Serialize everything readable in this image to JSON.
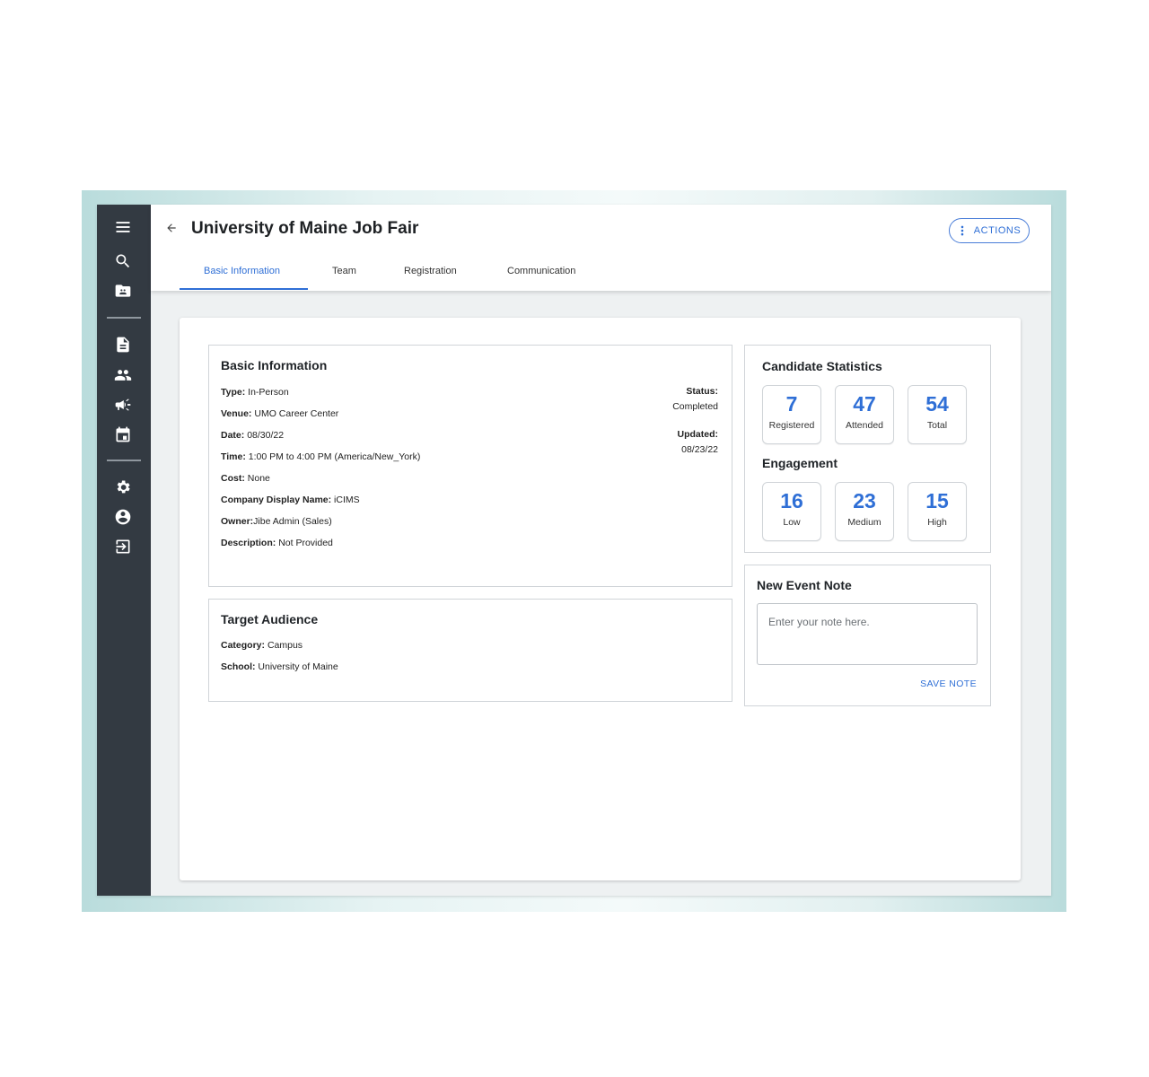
{
  "sidebar": {
    "icons": [
      "menu-icon",
      "search-icon",
      "folder-icon",
      "document-icon",
      "people-icon",
      "megaphone-icon",
      "calendar-icon",
      "gear-icon",
      "account-circle-icon",
      "logout-icon"
    ]
  },
  "header": {
    "title": "University of Maine Job Fair",
    "actions_label": "ACTIONS",
    "tabs": [
      {
        "label": "Basic Information",
        "active": true
      },
      {
        "label": "Team",
        "active": false
      },
      {
        "label": "Registration",
        "active": false
      },
      {
        "label": "Communication",
        "active": false
      }
    ]
  },
  "basic_info": {
    "title": "Basic Information",
    "fields": [
      {
        "label": "Type:",
        "value": "In-Person"
      },
      {
        "label": "Venue:",
        "value": "UMO Career Center"
      },
      {
        "label": "Date:",
        "value": "08/30/22"
      },
      {
        "label": "Time:",
        "value": "1:00 PM to 4:00 PM (America/New_York)"
      },
      {
        "label": "Cost:",
        "value": "None"
      },
      {
        "label": "Company Display Name:",
        "value": "iCIMS"
      },
      {
        "label": "Owner:",
        "value": "Jibe Admin (Sales)"
      },
      {
        "label": "Description:",
        "value": "Not Provided"
      }
    ],
    "status_label": "Status:",
    "status_value": "Completed",
    "updated_label": "Updated:",
    "updated_value": "08/23/22"
  },
  "target_audience": {
    "title": "Target Audience",
    "fields": [
      {
        "label": "Category:",
        "value": "Campus"
      },
      {
        "label": "School:",
        "value": "University of Maine"
      }
    ]
  },
  "candidate_statistics": {
    "title": "Candidate Statistics",
    "stats": [
      {
        "value": "7",
        "label": "Registered"
      },
      {
        "value": "47",
        "label": "Attended"
      },
      {
        "value": "54",
        "label": "Total"
      }
    ],
    "engagement_title": "Engagement",
    "engagement": [
      {
        "value": "16",
        "label": "Low"
      },
      {
        "value": "23",
        "label": "Medium"
      },
      {
        "value": "15",
        "label": "High"
      }
    ]
  },
  "event_note": {
    "title": "New Event Note",
    "placeholder": "Enter your note here.",
    "save_label": "SAVE NOTE"
  },
  "colors": {
    "sidebar": "#333a42",
    "accent": "#2f6fd6",
    "background": "#eef1f2"
  }
}
